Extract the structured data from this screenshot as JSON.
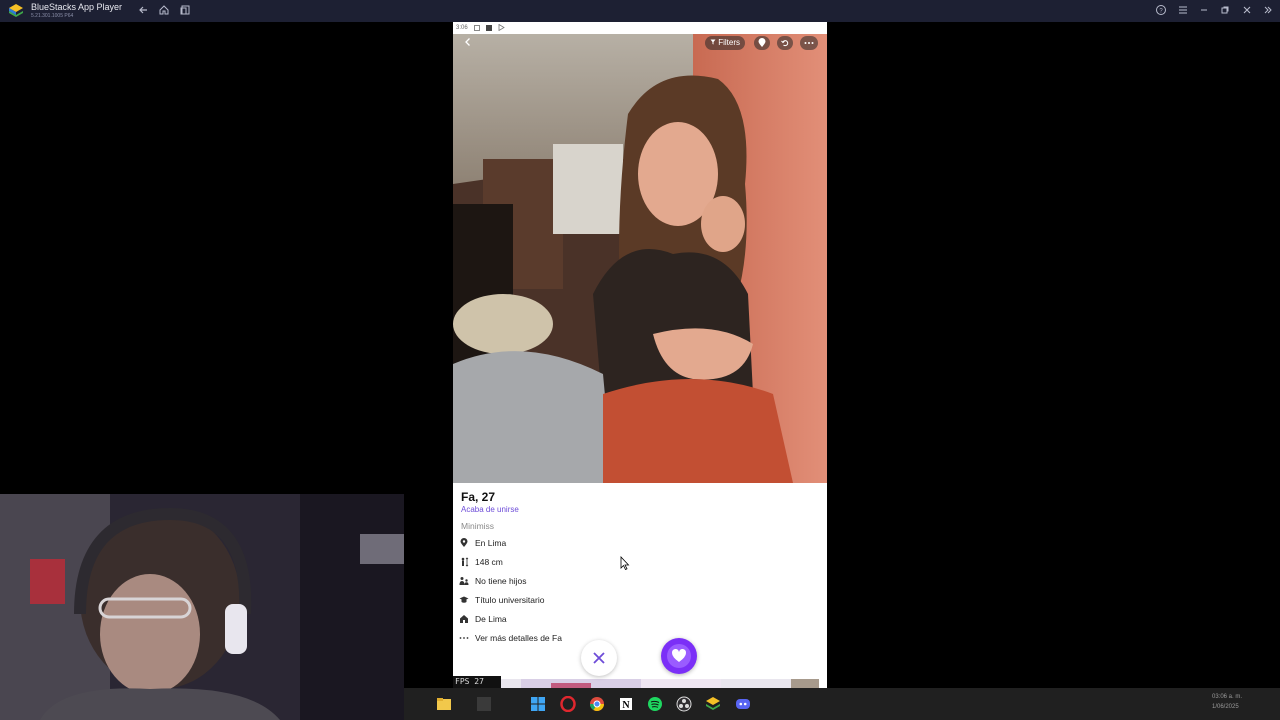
{
  "window": {
    "title": "BlueStacks App Player",
    "version": "5.21.301.1005 P64",
    "title_icons": [
      "back-arrow-icon",
      "home-icon",
      "multi-instance-icon"
    ],
    "control_icons": [
      "help-icon",
      "menu-icon",
      "minimize-icon",
      "restore-icon",
      "close-icon",
      "sidebar-toggle-icon"
    ]
  },
  "phone": {
    "status_time": "3:06",
    "top_bar": {
      "filters_label": "Filters"
    },
    "profile": {
      "name_age": "Fa, 27",
      "joined_label": "Acaba de unirse",
      "tagline": "Minimiss",
      "details": [
        {
          "icon": "location-pin-icon",
          "text": "En Lima"
        },
        {
          "icon": "height-icon",
          "text": "148 cm"
        },
        {
          "icon": "children-icon",
          "text": "No tiene hijos"
        },
        {
          "icon": "graduation-cap-icon",
          "text": "Título universitario"
        },
        {
          "icon": "hometown-icon",
          "text": "De Lima"
        },
        {
          "icon": "more-dots-icon",
          "text": "Ver más detalles de Fa"
        }
      ]
    },
    "actions": {
      "close_icon": "close-x-icon",
      "like_icon": "heart-icon",
      "like_color": "#7b2ff7"
    }
  },
  "overlay": {
    "fps_text": "FPS  27"
  },
  "taskbar": {
    "apps": [
      "file-explorer-icon",
      "search-icon",
      "windows-start-icon",
      "opera-icon",
      "chrome-icon",
      "notion-icon",
      "spotify-icon",
      "obs-icon",
      "bluestacks-icon",
      "discord-icon"
    ],
    "clock_time": "03:06 a. m.",
    "clock_date": "1/06/2025"
  },
  "colors": {
    "titlebar_bg": "#1d2033",
    "accent_purple": "#6d4cd8",
    "taskbar_bg": "#202020"
  }
}
